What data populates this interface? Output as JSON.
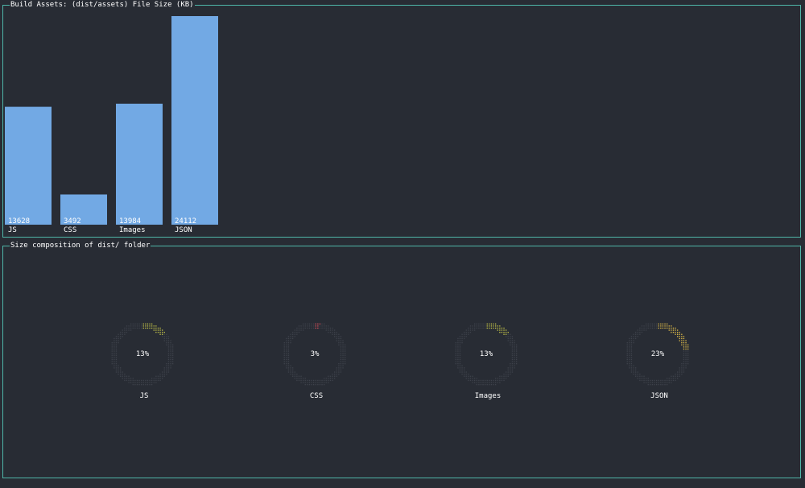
{
  "chart_data": [
    {
      "type": "bar",
      "title": "Build Assets: (dist/assets) File Size (KB)",
      "categories": [
        "JS",
        "CSS",
        "Images",
        "JSON"
      ],
      "values": [
        13628,
        3492,
        13984,
        24112
      ],
      "ylim": [
        0,
        24112
      ],
      "bar_color": "#72a9e4"
    },
    {
      "type": "pie",
      "title": "Size composition of dist/ folder",
      "style": "donut gauges",
      "categories": [
        "JS",
        "CSS",
        "Images",
        "JSON"
      ],
      "values": [
        13,
        3,
        13,
        23
      ],
      "percent_labels": [
        "13%",
        "3%",
        "13%",
        "23%"
      ],
      "colors": [
        "#c8c84a",
        "#e0535f",
        "#c8c84a",
        "#e5c04a"
      ],
      "track_color": "#3e424b"
    }
  ]
}
